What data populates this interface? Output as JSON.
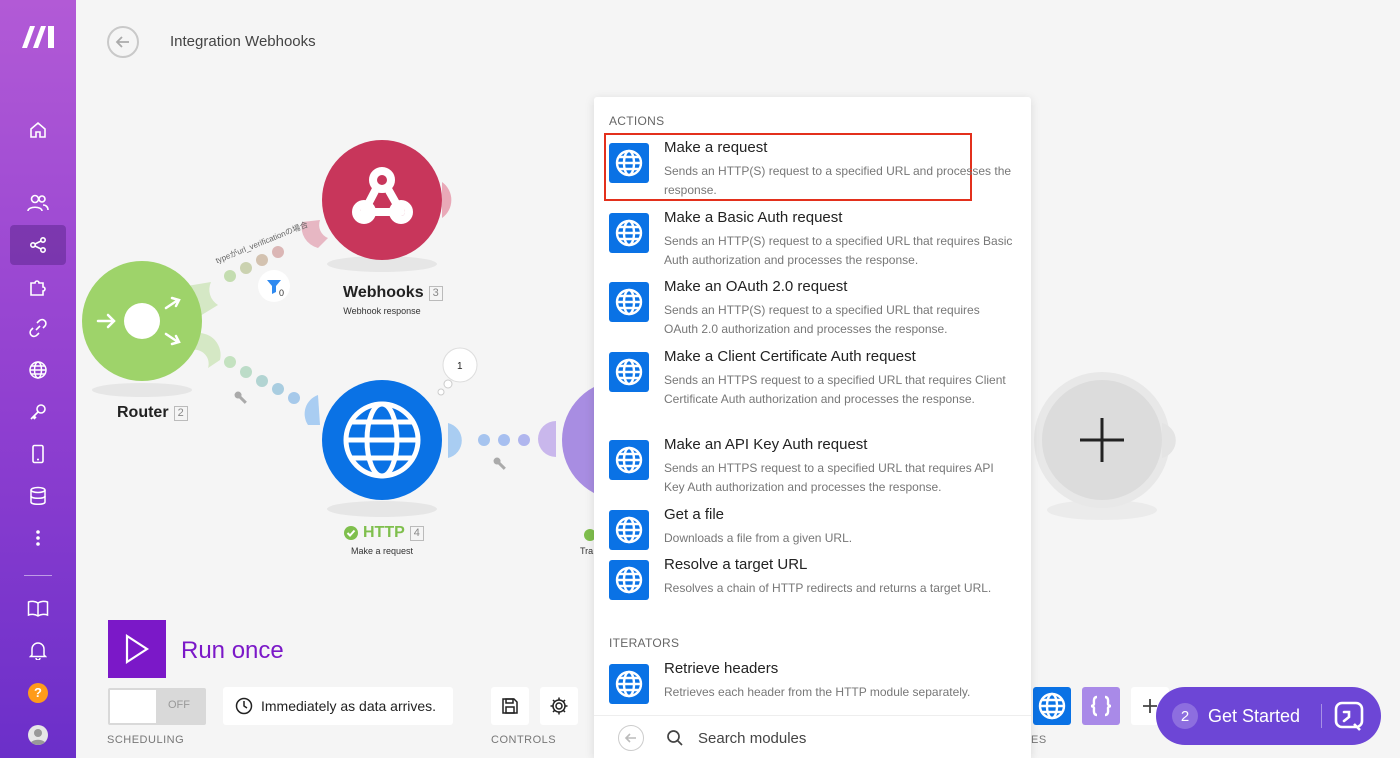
{
  "header": {
    "title": "Integration Webhooks"
  },
  "modules": {
    "webhooks": {
      "name": "Webhooks",
      "num": "3",
      "sub": "Webhook response"
    },
    "router": {
      "name": "Router",
      "num": "2"
    },
    "http": {
      "name": "HTTP",
      "num": "4",
      "sub": "Make a request"
    },
    "next": {
      "sub": "Tra"
    }
  },
  "filter": {
    "label": "typeがurl_verificationの場合",
    "count": "0"
  },
  "http_bubble": "1",
  "run": {
    "label": "Run once"
  },
  "scheduling": {
    "toggle": "OFF",
    "schedule_text": "Immediately as data arrives.",
    "section": "SCHEDULING"
  },
  "controls": {
    "section": "CONTROLS"
  },
  "tools": {
    "section_partial": "ES"
  },
  "get_started": {
    "count": "2",
    "label": "Get Started"
  },
  "panel": {
    "section_actions": "ACTIONS",
    "section_iterators": "ITERATORS",
    "items": [
      {
        "title": "Make a request",
        "desc": "Sends an HTTP(S) request to a specified URL and processes the response."
      },
      {
        "title": "Make a Basic Auth request",
        "desc": "Sends an HTTP(S) request to a specified URL that requires Basic Auth authorization and processes the response."
      },
      {
        "title": "Make an OAuth 2.0 request",
        "desc": "Sends an HTTP(S) request to a specified URL that requires OAuth 2.0 authorization and processes the response."
      },
      {
        "title": "Make a Client Certificate Auth request",
        "desc": "Sends an HTTPS request to a specified URL that requires Client Certificate Auth authorization and processes the response."
      },
      {
        "title": "Make an API Key Auth request",
        "desc": "Sends an HTTPS request to a specified URL that requires API Key Auth authorization and processes the response."
      },
      {
        "title": "Get a file",
        "desc": "Downloads a file from a given URL."
      },
      {
        "title": "Resolve a target URL",
        "desc": "Resolves a chain of HTTP redirects and returns a target URL."
      },
      {
        "title": "Retrieve headers",
        "desc": "Retrieves each header from the HTTP module separately."
      }
    ],
    "search_placeholder": "Search modules"
  },
  "colors": {
    "brand": "#7b18c8",
    "http": "#0a72e5",
    "webhooks": "#c8365b",
    "router": "#9ed36a",
    "highlight": "#e3301c"
  }
}
